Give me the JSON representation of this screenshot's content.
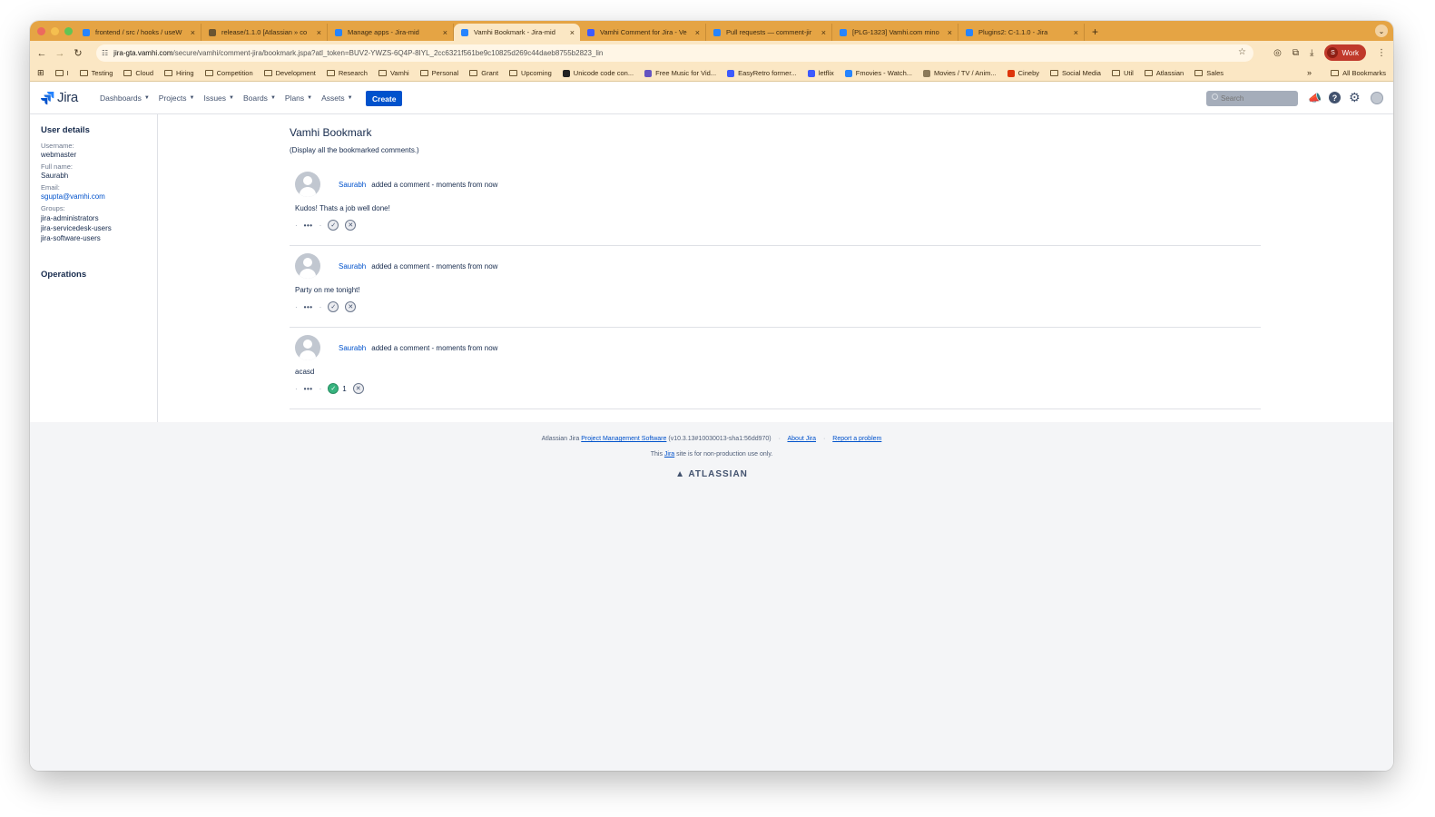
{
  "browser": {
    "tabs": [
      {
        "title": "frontend / src / hooks / useW",
        "color": "#2684ff",
        "active": false
      },
      {
        "title": "release/1.1.0 [Atlassian » co",
        "color": "#6b5531",
        "active": false
      },
      {
        "title": "Manage apps - Jira-mid",
        "color": "#2684ff",
        "active": false
      },
      {
        "title": "Vamhi Bookmark - Jira-mid",
        "color": "#2684ff",
        "active": true
      },
      {
        "title": "Vamhi Comment for Jira - Ve",
        "color": "#3d5afe",
        "active": false
      },
      {
        "title": "Pull requests — comment-jir",
        "color": "#2684ff",
        "active": false
      },
      {
        "title": "[PLG-1323] Vamhi.com mino",
        "color": "#2684ff",
        "active": false
      },
      {
        "title": "Plugins2: C-1.1.0 - Jira",
        "color": "#2684ff",
        "active": false
      }
    ],
    "url_host": "jira-gta.vamhi.com",
    "url_path": "/secure/vamhi/comment-jira/bookmark.jspa?atl_token=BUV2-YWZS-6Q4P-8IYL_2cc6321f561be9c10825d269c44daeb8755b2823_lin",
    "profile_initial": "S",
    "profile_label": "Work",
    "bookmarks": [
      {
        "label": "I",
        "type": "folder"
      },
      {
        "label": "Testing",
        "type": "folder"
      },
      {
        "label": "Cloud",
        "type": "folder"
      },
      {
        "label": "Hiring",
        "type": "folder"
      },
      {
        "label": "Competition",
        "type": "folder"
      },
      {
        "label": "Development",
        "type": "folder"
      },
      {
        "label": "Research",
        "type": "folder"
      },
      {
        "label": "Vamhi",
        "type": "folder"
      },
      {
        "label": "Personal",
        "type": "folder"
      },
      {
        "label": "Grant",
        "type": "folder"
      },
      {
        "label": "Upcoming",
        "type": "folder"
      },
      {
        "label": "Unicode code con...",
        "type": "site",
        "color": "#222222"
      },
      {
        "label": "Free Music for Vid...",
        "type": "site",
        "color": "#6554c0"
      },
      {
        "label": "EasyRetro former...",
        "type": "site",
        "color": "#3d5afe"
      },
      {
        "label": "letflix",
        "type": "site",
        "color": "#3d5afe"
      },
      {
        "label": "Fmovies - Watch...",
        "type": "site",
        "color": "#2684ff"
      },
      {
        "label": "Movies / TV / Anim...",
        "type": "site",
        "color": "#8c7a5a"
      },
      {
        "label": "Cineby",
        "type": "site",
        "color": "#de350b"
      },
      {
        "label": "Social Media",
        "type": "folder"
      },
      {
        "label": "Util",
        "type": "folder"
      },
      {
        "label": "Atlassian",
        "type": "folder"
      },
      {
        "label": "Sales",
        "type": "folder"
      }
    ],
    "all_bookmarks": "All Bookmarks"
  },
  "jira": {
    "logo_text": "Jira",
    "menu": [
      "Dashboards",
      "Projects",
      "Issues",
      "Boards",
      "Plans",
      "Assets"
    ],
    "create_label": "Create",
    "search_placeholder": "Search"
  },
  "sidebar": {
    "title": "User details",
    "username_label": "Username:",
    "username": "webmaster",
    "fullname_label": "Full name:",
    "fullname": "Saurabh",
    "email_label": "Email:",
    "email": "sgupta@vamhi.com",
    "groups_label": "Groups:",
    "groups": [
      "jira-administrators",
      "jira-servicedesk-users",
      "jira-software-users"
    ],
    "operations": "Operations"
  },
  "main": {
    "title": "Vamhi Bookmark",
    "subtitle": "(Display all the bookmarked comments.)",
    "comments": [
      {
        "author": "Saurabh",
        "action": "added a comment - moments from now",
        "body": "Kudos! Thats a job well done!",
        "liked": false,
        "count": ""
      },
      {
        "author": "Saurabh",
        "action": "added a comment - moments from now",
        "body": "Party on me tonight!",
        "liked": false,
        "count": ""
      },
      {
        "author": "Saurabh",
        "action": "added a comment - moments from now",
        "body": "acasd",
        "liked": true,
        "count": "1"
      }
    ]
  },
  "footer": {
    "prefix": "Atlassian Jira",
    "pm_link": "Project Management Software",
    "version": "(v10.3.13#10030013-sha1:56dd970)",
    "about": "About Jira",
    "report": "Report a problem",
    "nonprod_before": "This",
    "nonprod_link": "Jira",
    "nonprod_after": "site is for non-production use only.",
    "brand": "ATLASSIAN"
  }
}
